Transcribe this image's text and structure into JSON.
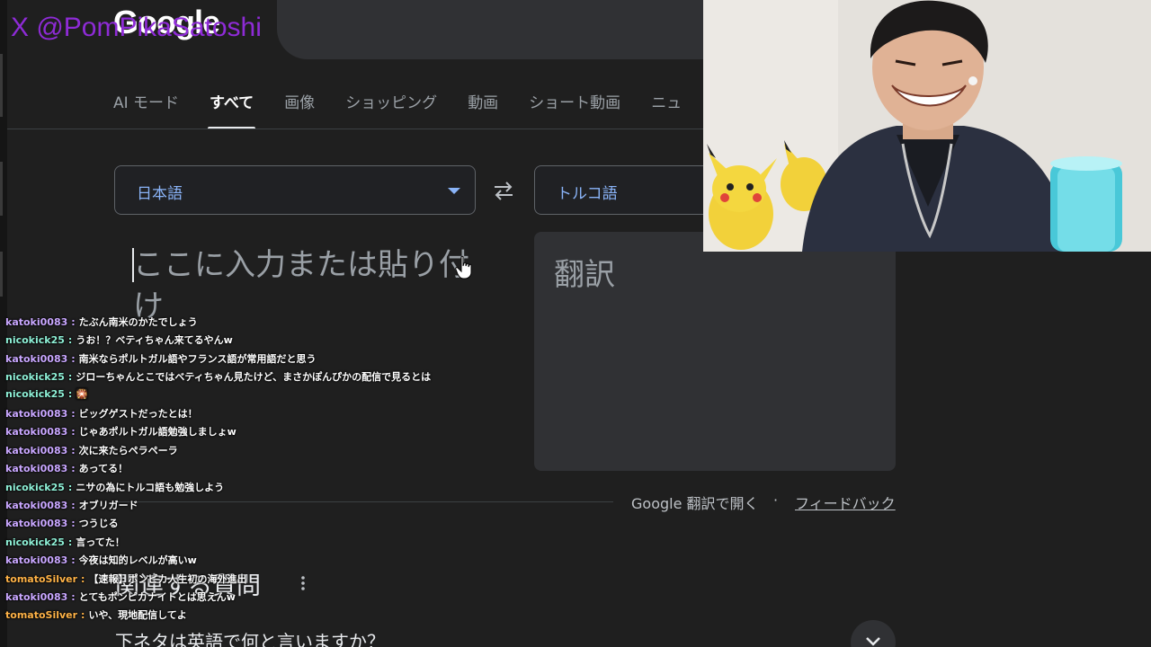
{
  "watermark": "X @PomPikaSatoshi",
  "logo": "Google",
  "tabs": [
    "AI モード",
    "すべて",
    "画像",
    "ショッピング",
    "動画",
    "ショート動画",
    "ニュ"
  ],
  "active_tab_index": 1,
  "translate": {
    "source_lang": "日本語",
    "target_lang": "トルコ語",
    "input_placeholder": "ここに入力または貼り付け",
    "output_placeholder": "翻訳",
    "open_in_translate": "Google 翻訳で開く",
    "separator": "·",
    "feedback": "フィードバック"
  },
  "related_questions": {
    "title": "関連する質問",
    "items": [
      "下ネタは英語で何と言いますか？"
    ]
  },
  "chat": {
    "messages": [
      {
        "user": "katoki0083",
        "text": "たぶん南米のかたでしょう"
      },
      {
        "user": "nicokick25",
        "text": "うお！？ベティちゃん来てるやんw"
      },
      {
        "user": "katoki0083",
        "text": "南米ならポルトガル語やフランス語が常用語だと思う"
      },
      {
        "user": "nicokick25",
        "text": "ジローちゃんとこではベティちゃん見たけど、まさかぽんぴかの配信で見るとは"
      },
      {
        "user": "nicokick25",
        "text": "🎇"
      },
      {
        "user": "katoki0083",
        "text": "ビッグゲストだったとは！"
      },
      {
        "user": "katoki0083",
        "text": "じゃあポルトガル語勉強しましょw"
      },
      {
        "user": "katoki0083",
        "text": "次に来たらペラペーラ"
      },
      {
        "user": "katoki0083",
        "text": "あってる！"
      },
      {
        "user": "nicokick25",
        "text": "ニサの為にトルコ語も勉強しよう"
      },
      {
        "user": "katoki0083",
        "text": "オブリガード"
      },
      {
        "user": "katoki0083",
        "text": "つうじる"
      },
      {
        "user": "nicokick25",
        "text": "言ってた！"
      },
      {
        "user": "katoki0083",
        "text": "今夜は知的レベルが高いw"
      },
      {
        "user": "tomatoSilver",
        "text": "【速報】ポンピカ人生初の海外進出"
      },
      {
        "user": "katoki0083",
        "text": "とてもポンピカナイトとは思えんw"
      },
      {
        "user": "tomatoSilver",
        "text": "いや、現地配信してよ"
      }
    ],
    "user_colors": {
      "katoki0083": "#c9a7ff",
      "nicokick25": "#8ef0d6",
      "tomatoSilver": "#ffb347"
    }
  }
}
